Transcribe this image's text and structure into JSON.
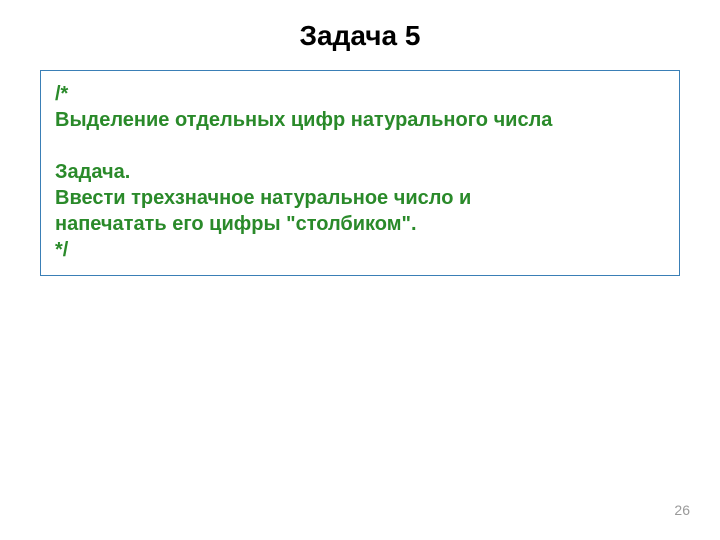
{
  "slide": {
    "title": "Задача 5"
  },
  "code": {
    "line1": "/*",
    "line2": "Выделение отдельных цифр натурального числа",
    "line3": "Задача.",
    "line4": "Ввести трехзначное натуральное число и",
    "line5": "напечатать его цифры \"столбиком\".",
    "line6": "*/"
  },
  "page_number": "26"
}
